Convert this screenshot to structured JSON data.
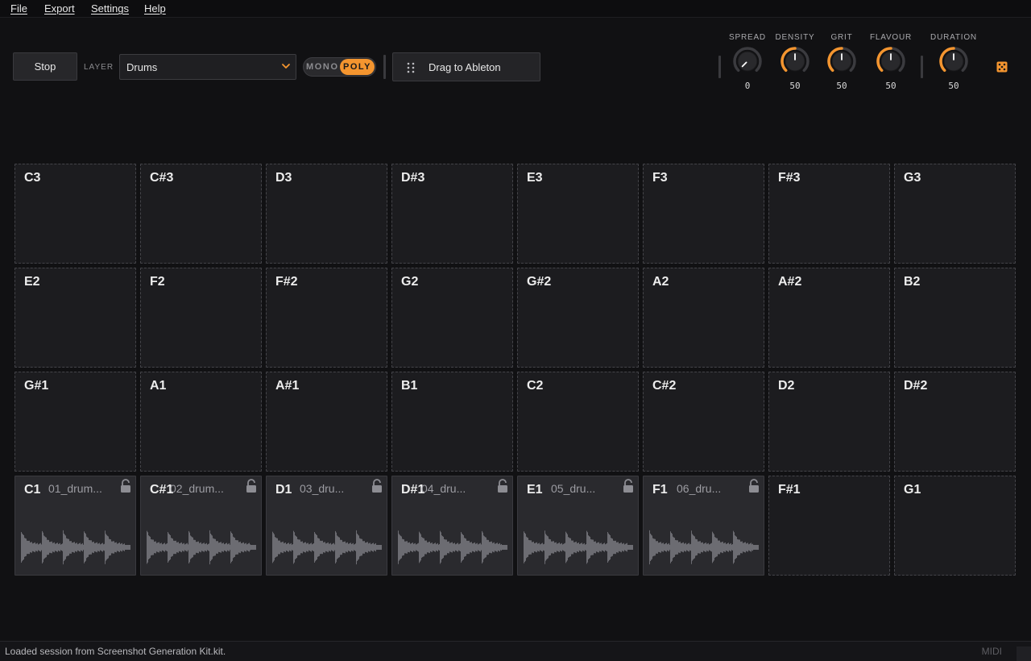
{
  "menu": [
    "File",
    "Export",
    "Settings",
    "Help"
  ],
  "toolbar": {
    "stop_label": "Stop",
    "layer_label": "LAYER",
    "layer_value": "Drums",
    "mono_label": "MONO",
    "poly_label": "POLY",
    "drag_label": "Drag to Ableton"
  },
  "knobs": [
    {
      "label": "SPREAD",
      "value": 0
    },
    {
      "label": "DENSITY",
      "value": 50
    },
    {
      "label": "GRIT",
      "value": 50
    },
    {
      "label": "FLAVOUR",
      "value": 50
    },
    {
      "label": "DURATION",
      "value": 50
    }
  ],
  "colors": {
    "accent": "#f4952f",
    "pad_bg": "#1c1c1f",
    "pad_loaded_bg": "#2a2a2e",
    "waveform": "#6c6c72"
  },
  "pad_rows": [
    [
      {
        "note": "C3"
      },
      {
        "note": "C#3"
      },
      {
        "note": "D3"
      },
      {
        "note": "D#3"
      },
      {
        "note": "E3"
      },
      {
        "note": "F3"
      },
      {
        "note": "F#3"
      },
      {
        "note": "G3"
      }
    ],
    [
      {
        "note": "E2"
      },
      {
        "note": "F2"
      },
      {
        "note": "F#2"
      },
      {
        "note": "G2"
      },
      {
        "note": "G#2"
      },
      {
        "note": "A2"
      },
      {
        "note": "A#2"
      },
      {
        "note": "B2"
      }
    ],
    [
      {
        "note": "G#1"
      },
      {
        "note": "A1"
      },
      {
        "note": "A#1"
      },
      {
        "note": "B1"
      },
      {
        "note": "C2"
      },
      {
        "note": "C#2"
      },
      {
        "note": "D2"
      },
      {
        "note": "D#2"
      }
    ],
    [
      {
        "note": "C1",
        "sample": "01_drum...",
        "locked": false
      },
      {
        "note": "C#1",
        "sample": "02_drum...",
        "locked": false
      },
      {
        "note": "D1",
        "sample": "03_dru...",
        "locked": false
      },
      {
        "note": "D#1",
        "sample": "04_dru...",
        "locked": false
      },
      {
        "note": "E1",
        "sample": "05_dru...",
        "locked": false
      },
      {
        "note": "F1",
        "sample": "06_dru...",
        "locked": false
      },
      {
        "note": "F#1"
      },
      {
        "note": "G1"
      }
    ]
  ],
  "status": {
    "message": "Loaded session from Screenshot Generation Kit.kit.",
    "midi_label": "MIDI"
  }
}
